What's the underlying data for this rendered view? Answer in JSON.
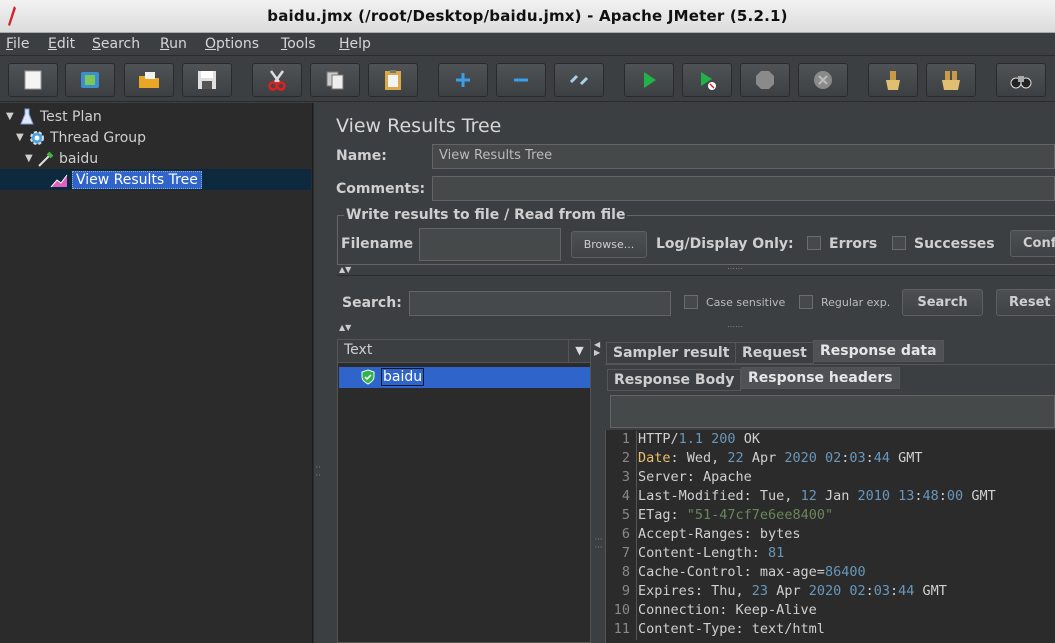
{
  "window": {
    "title": "baidu.jmx (/root/Desktop/baidu.jmx) - Apache JMeter (5.2.1)"
  },
  "menu": [
    "File",
    "Edit",
    "Search",
    "Run",
    "Options",
    "Tools",
    "Help"
  ],
  "toolbar": {
    "icons": [
      "new-icon",
      "templates-icon",
      "open-icon",
      "save-icon",
      "cut-icon",
      "copy-icon",
      "paste-icon",
      "expand-icon",
      "collapse-icon",
      "toggle-icon",
      "start-icon",
      "start-no-pause-icon",
      "stop-icon",
      "shutdown-icon",
      "clear-icon",
      "clear-all-icon",
      "search-icon"
    ]
  },
  "tree": {
    "items": [
      {
        "label": "Test Plan",
        "icon": "test-plan-icon"
      },
      {
        "label": "Thread Group",
        "icon": "thread-group-icon"
      },
      {
        "label": "baidu",
        "icon": "sampler-icon"
      },
      {
        "label": "View Results Tree",
        "icon": "listener-icon",
        "selected": true
      }
    ]
  },
  "panel": {
    "heading": "View Results Tree",
    "name_label": "Name:",
    "name_value": "View Results Tree",
    "comments_label": "Comments:",
    "comments_value": "",
    "write_group": "Write results to file / Read from file",
    "filename_label": "Filename",
    "filename_value": "",
    "browse": "Browse...",
    "log_display": "Log/Display Only:",
    "errors": "Errors",
    "successes": "Successes",
    "configure": "Configure"
  },
  "search": {
    "label": "Search:",
    "value": "",
    "case_sensitive": "Case sensitive",
    "regular_exp": "Regular exp.",
    "search_button": "Search",
    "reset_button": "Reset"
  },
  "results": {
    "renderer": "Text",
    "items": [
      {
        "label": "baidu",
        "status": "success"
      }
    ]
  },
  "tabs": {
    "top": [
      "Sampler result",
      "Request",
      "Response data"
    ],
    "top_selected": "Response data",
    "sub": [
      "Response Body",
      "Response headers"
    ],
    "sub_selected": "Response headers"
  },
  "response_headers": [
    "HTTP/1.1 200 OK",
    "Date: Wed, 22 Apr 2020 02:03:44 GMT",
    "Server: Apache",
    "Last-Modified: Tue, 12 Jan 2010 13:48:00 GMT",
    "ETag: \"51-47cf7e6ee8400\"",
    "Accept-Ranges: bytes",
    "Content-Length: 81",
    "Cache-Control: max-age=86400",
    "Expires: Thu, 23 Apr 2020 02:03:44 GMT",
    "Connection: Keep-Alive",
    "Content-Type: text/html"
  ],
  "colors": {
    "selection": "#2f65ca",
    "background": "#3c3f41",
    "success": "#2fb34a"
  }
}
